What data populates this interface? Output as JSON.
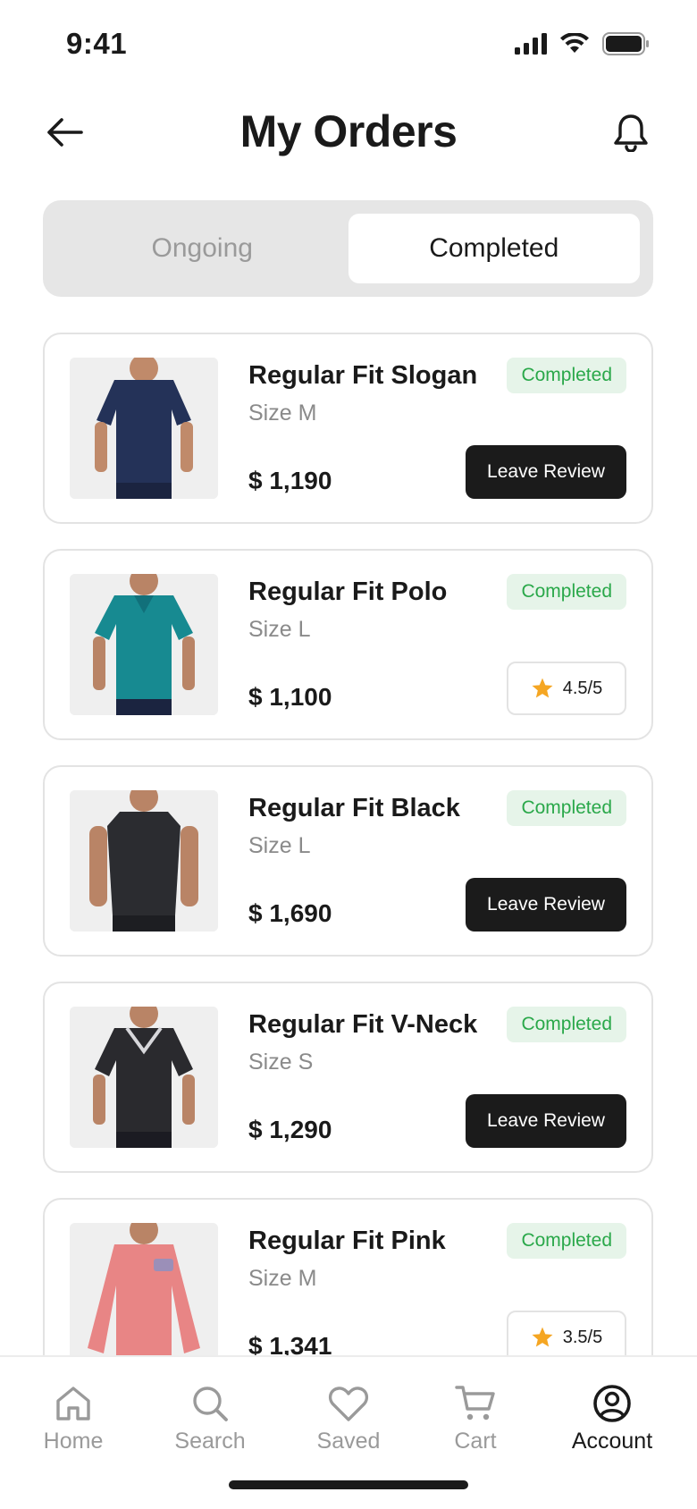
{
  "status_bar": {
    "time": "9:41"
  },
  "header": {
    "title": "My Orders"
  },
  "tabs": [
    {
      "label": "Ongoing",
      "active": false
    },
    {
      "label": "Completed",
      "active": true
    }
  ],
  "orders": [
    {
      "name": "Regular Fit Slogan",
      "size": "Size M",
      "price": "$ 1,190",
      "status": "Completed",
      "action": "Leave Review"
    },
    {
      "name": "Regular Fit Polo",
      "size": "Size L",
      "price": "$ 1,100",
      "status": "Completed",
      "rating": "4.5/5"
    },
    {
      "name": "Regular Fit Black",
      "size": "Size L",
      "price": "$ 1,690",
      "status": "Completed",
      "action": "Leave Review"
    },
    {
      "name": "Regular Fit V-Neck",
      "size": "Size S",
      "price": "$ 1,290",
      "status": "Completed",
      "action": "Leave Review"
    },
    {
      "name": "Regular Fit Pink",
      "size": "Size M",
      "price": "$ 1,341",
      "status": "Completed",
      "rating": "3.5/5"
    }
  ],
  "bottom_nav": [
    {
      "label": "Home",
      "icon": "home-icon",
      "active": false
    },
    {
      "label": "Search",
      "icon": "search-icon",
      "active": false
    },
    {
      "label": "Saved",
      "icon": "heart-icon",
      "active": false
    },
    {
      "label": "Cart",
      "icon": "cart-icon",
      "active": false
    },
    {
      "label": "Account",
      "icon": "account-icon",
      "active": true
    }
  ],
  "colors": {
    "status_green": "#2aa84a",
    "status_green_bg": "#e6f4e9",
    "button_dark": "#1b1b1b",
    "star": "#f5a623",
    "muted": "#9a9a9a"
  }
}
